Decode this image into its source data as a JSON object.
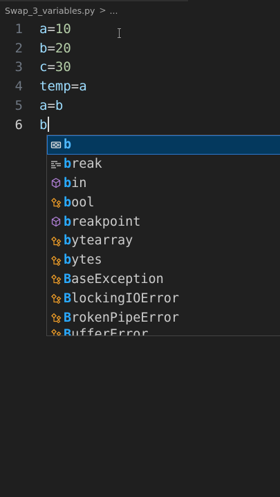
{
  "breadcrumb": {
    "file": "Swap_3_variables.py",
    "separator": ">",
    "more": "..."
  },
  "editor": {
    "lines": [
      {
        "number": "1",
        "tokens": [
          {
            "t": "a",
            "c": "var"
          },
          {
            "t": "=",
            "c": "op"
          },
          {
            "t": "10",
            "c": "num"
          }
        ]
      },
      {
        "number": "2",
        "tokens": [
          {
            "t": "b",
            "c": "var"
          },
          {
            "t": "=",
            "c": "op"
          },
          {
            "t": "20",
            "c": "num"
          }
        ]
      },
      {
        "number": "3",
        "tokens": [
          {
            "t": "c",
            "c": "var"
          },
          {
            "t": "=",
            "c": "op"
          },
          {
            "t": "30",
            "c": "num"
          }
        ]
      },
      {
        "number": "4",
        "tokens": [
          {
            "t": "temp",
            "c": "var"
          },
          {
            "t": "=",
            "c": "op"
          },
          {
            "t": "a",
            "c": "var"
          }
        ]
      },
      {
        "number": "5",
        "tokens": [
          {
            "t": "a",
            "c": "var"
          },
          {
            "t": "=",
            "c": "op"
          },
          {
            "t": "b",
            "c": "var"
          }
        ]
      },
      {
        "number": "6",
        "tokens": [
          {
            "t": "b",
            "c": "var"
          }
        ],
        "active": true,
        "cursor": true
      }
    ]
  },
  "suggestions": {
    "items": [
      {
        "match": "b",
        "rest": "",
        "icon": "variable-icon",
        "selected": true
      },
      {
        "match": "b",
        "rest": "reak",
        "icon": "keyword-icon"
      },
      {
        "match": "b",
        "rest": "in",
        "icon": "function-icon"
      },
      {
        "match": "b",
        "rest": "ool",
        "icon": "class-icon"
      },
      {
        "match": "b",
        "rest": "reakpoint",
        "icon": "function-icon"
      },
      {
        "match": "b",
        "rest": "ytearray",
        "icon": "class-icon"
      },
      {
        "match": "b",
        "rest": "ytes",
        "icon": "class-icon"
      },
      {
        "match": "B",
        "rest": "aseException",
        "icon": "class-icon"
      },
      {
        "match": "B",
        "rest": "lockingIOError",
        "icon": "class-icon"
      },
      {
        "match": "B",
        "rest": "rokenPipeError",
        "icon": "class-icon"
      },
      {
        "match": "B",
        "rest": "ufferError",
        "icon": "class-icon",
        "cut": true
      }
    ]
  },
  "colors": {
    "background": "#1f1f1f",
    "variable": "#9cdcfe",
    "number": "#b5cea8",
    "match_highlight": "#2aaaff",
    "selection": "#04395e",
    "class_icon": "#ee9d28",
    "function_icon": "#b180d7"
  }
}
